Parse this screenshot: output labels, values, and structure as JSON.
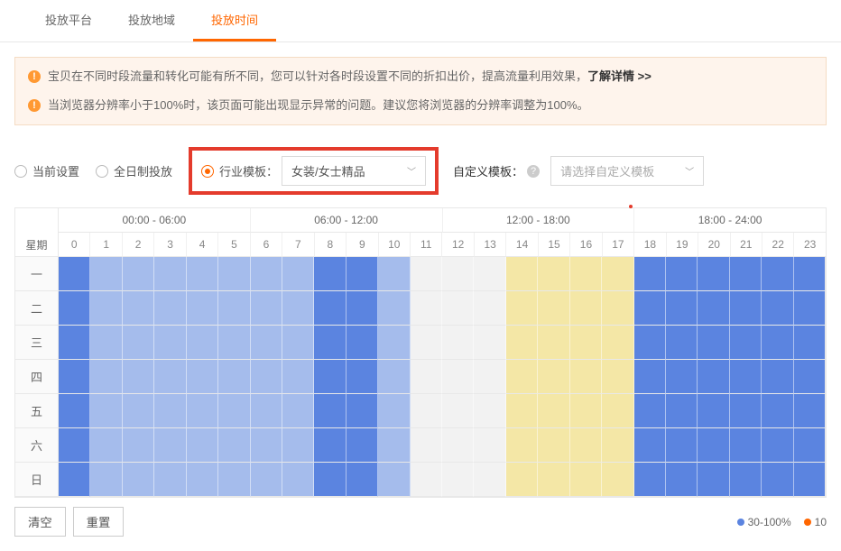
{
  "tabs": {
    "t0": "投放平台",
    "t1": "投放地域",
    "t2": "投放时间"
  },
  "alerts": {
    "a0_pre": "宝贝在不同时段流量和转化可能有所不同，您可以针对各时段设置不同的折扣出价，提高流量利用效果，",
    "a0_link": "了解详情 >>",
    "a1": "当浏览器分辨率小于100%时，该页面可能出现显示异常的问题。建议您将浏览器的分辨率调整为100%。"
  },
  "options": {
    "current": "当前设置",
    "allday": "全日制投放",
    "industry_label": "行业模板：",
    "industry_value": "女装/女士精品",
    "custom_label": "自定义模板：",
    "custom_placeholder": "请选择自定义模板"
  },
  "grid": {
    "corner": "星期",
    "ranges": [
      "00:00 - 06:00",
      "06:00 - 12:00",
      "12:00 - 18:00",
      "18:00 - 24:00"
    ],
    "hours": [
      "0",
      "1",
      "2",
      "3",
      "4",
      "5",
      "6",
      "7",
      "8",
      "9",
      "10",
      "11",
      "12",
      "13",
      "14",
      "15",
      "16",
      "17",
      "18",
      "19",
      "20",
      "21",
      "22",
      "23"
    ],
    "days": [
      "一",
      "二",
      "三",
      "四",
      "五",
      "六",
      "日"
    ]
  },
  "schedule_colors": {
    "comment": "per-hour color class per day; d=dark-blue, b=light-blue, g=gray, y=yellow",
    "rows": [
      [
        "d",
        "b",
        "b",
        "b",
        "b",
        "b",
        "b",
        "b",
        "d",
        "d",
        "b",
        "g",
        "g",
        "g",
        "y",
        "y",
        "y",
        "y",
        "d",
        "d",
        "d",
        "d",
        "d",
        "d"
      ],
      [
        "d",
        "b",
        "b",
        "b",
        "b",
        "b",
        "b",
        "b",
        "d",
        "d",
        "b",
        "g",
        "g",
        "g",
        "y",
        "y",
        "y",
        "y",
        "d",
        "d",
        "d",
        "d",
        "d",
        "d"
      ],
      [
        "d",
        "b",
        "b",
        "b",
        "b",
        "b",
        "b",
        "b",
        "d",
        "d",
        "b",
        "g",
        "g",
        "g",
        "y",
        "y",
        "y",
        "y",
        "d",
        "d",
        "d",
        "d",
        "d",
        "d"
      ],
      [
        "d",
        "b",
        "b",
        "b",
        "b",
        "b",
        "b",
        "b",
        "d",
        "d",
        "b",
        "g",
        "g",
        "g",
        "y",
        "y",
        "y",
        "y",
        "d",
        "d",
        "d",
        "d",
        "d",
        "d"
      ],
      [
        "d",
        "b",
        "b",
        "b",
        "b",
        "b",
        "b",
        "b",
        "d",
        "d",
        "b",
        "g",
        "g",
        "g",
        "y",
        "y",
        "y",
        "y",
        "d",
        "d",
        "d",
        "d",
        "d",
        "d"
      ],
      [
        "d",
        "b",
        "b",
        "b",
        "b",
        "b",
        "b",
        "b",
        "d",
        "d",
        "b",
        "g",
        "g",
        "g",
        "y",
        "y",
        "y",
        "y",
        "d",
        "d",
        "d",
        "d",
        "d",
        "d"
      ],
      [
        "d",
        "b",
        "b",
        "b",
        "b",
        "b",
        "b",
        "b",
        "d",
        "d",
        "b",
        "g",
        "g",
        "g",
        "y",
        "y",
        "y",
        "y",
        "d",
        "d",
        "d",
        "d",
        "d",
        "d"
      ]
    ]
  },
  "buttons": {
    "clear": "清空",
    "reset": "重置"
  },
  "legend": {
    "l0": "30-100%",
    "l1": "10"
  }
}
